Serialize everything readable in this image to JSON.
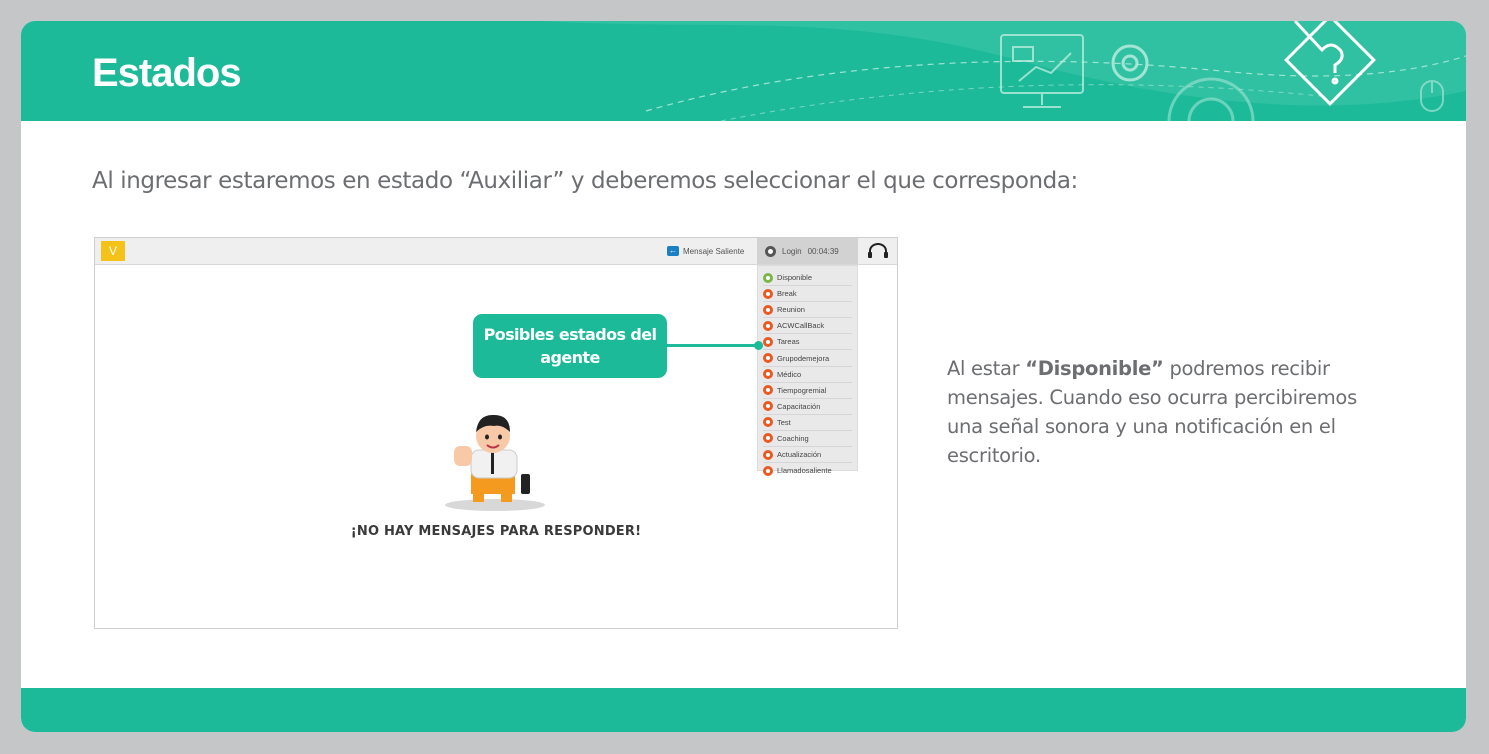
{
  "slide": {
    "title": "Estados",
    "intro": "Al ingresar estaremos en estado “Auxiliar” y deberemos seleccionar el que corresponda:",
    "side_text": {
      "prefix": "Al estar ",
      "bold": "“Disponible”",
      "suffix": " podremos recibir mensajes. Cuando eso ocurra percibiremos una señal sonora y una notificación en el escritorio."
    }
  },
  "app": {
    "logo": "V",
    "outgoing_message": "Mensaje Saliente",
    "login_label": "Login",
    "login_timer": "00:04:39",
    "status_options": [
      {
        "label": "Disponible",
        "color": "#7ab648"
      },
      {
        "label": "Break",
        "color": "#e95a24"
      },
      {
        "label": "Reunion",
        "color": "#e95a24"
      },
      {
        "label": "ACWCallBack",
        "color": "#e95a24"
      },
      {
        "label": "Tareas",
        "color": "#e95a24"
      },
      {
        "label": "Grupodemejora",
        "color": "#e95a24"
      },
      {
        "label": "Médico",
        "color": "#e95a24"
      },
      {
        "label": "Tiempogremial",
        "color": "#e95a24"
      },
      {
        "label": "Capacitación",
        "color": "#e95a24"
      },
      {
        "label": "Test",
        "color": "#e95a24"
      },
      {
        "label": "Coaching",
        "color": "#e95a24"
      },
      {
        "label": "Actualización",
        "color": "#e95a24"
      },
      {
        "label": "Llamadosaliente",
        "color": "#e95a24"
      }
    ],
    "callout": "Posibles estados del agente",
    "empty_message": "¡NO HAY MENSAJES PARA RESPONDER!"
  },
  "colors": {
    "brand": "#1dba9a",
    "available": "#7ab648",
    "unavailable": "#e95a24"
  }
}
